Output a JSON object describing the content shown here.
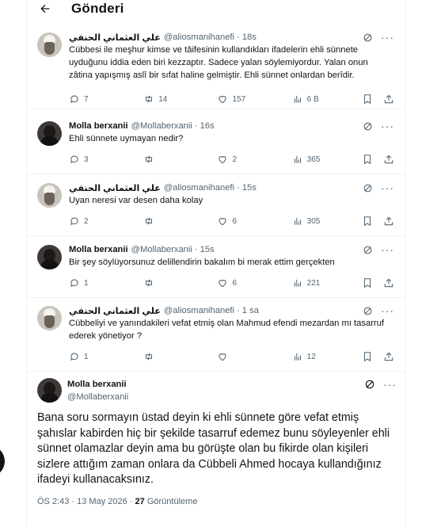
{
  "header": {
    "title": "Gönderi"
  },
  "tweets": [
    {
      "name": "علي العثماني الحنفي",
      "handle": "@aliosmanihanefi",
      "time": "18s",
      "text": "Cübbesi ile meşhur kimse ve tâifesinin kullandıkları ifadelerin ehli sünnete uyduğunu iddia eden biri kezzaptır. Sadece yalan söylemiyordur. Yalan onun zâtina yapışmış aslî bir sıfat haline gelmiştir. Ehli sünnet onlardan berîdir.",
      "replies": "7",
      "reposts": "14",
      "likes": "157",
      "views": "6 B"
    },
    {
      "name": "Molla berxanii",
      "handle": "@Mollaberxanii",
      "time": "16s",
      "text": "Ehli sünnete uymayan nedir?",
      "replies": "3",
      "reposts": "",
      "likes": "2",
      "views": "365"
    },
    {
      "name": "علي العثماني الحنفي",
      "handle": "@aliosmanihanefi",
      "time": "15s",
      "text": "Uyan neresi var desen daha kolay",
      "replies": "2",
      "reposts": "",
      "likes": "6",
      "views": "305"
    },
    {
      "name": "Molla berxanii",
      "handle": "@Mollaberxanii",
      "time": "15s",
      "text": "Bir şey söylüyorsunuz delillendirin bakalım bi merak ettim gerçekten",
      "replies": "1",
      "reposts": "",
      "likes": "6",
      "views": "221"
    },
    {
      "name": "علي العثماني الحنفي",
      "handle": "@aliosmanihanefi",
      "time": "1 sa",
      "text": "Cübbeliyi ve yanındakileri vefat etmiş olan Mahmud efendi mezardan mı tasarruf ederek yönetiyor ?",
      "replies": "1",
      "reposts": "",
      "likes": "",
      "views": "12"
    }
  ],
  "main": {
    "name": "Molla berxanii",
    "handle": "@Mollaberxanii",
    "text": "Bana soru sormayın üstad deyin ki ehli sünnete göre vefat etmiş şahıslar kabirden hiç bir şekilde tasarruf edemez bunu söyleyenler ehli sünnet olamazlar deyin ama bu görüşte olan bu fikirde olan kişileri sizlere attığım zaman onlara da Cübbeli Ahmed hocaya kullandığınız ifadeyi kullanacaksınız.",
    "timestamp": "ÖS 2:43 · 13 May 2026",
    "views_count": "27",
    "views_label": "Görüntüleme"
  },
  "icons": {
    "back": "arrow-left-icon",
    "grok": "grok-icon",
    "more": "more-icon",
    "reply": "reply-icon",
    "repost": "repost-icon",
    "like": "like-icon",
    "views": "views-icon",
    "bookmark": "bookmark-icon",
    "share": "share-icon"
  },
  "colors": {
    "text": "#0f1419",
    "secondary": "#536471",
    "border": "#eff3f4"
  }
}
